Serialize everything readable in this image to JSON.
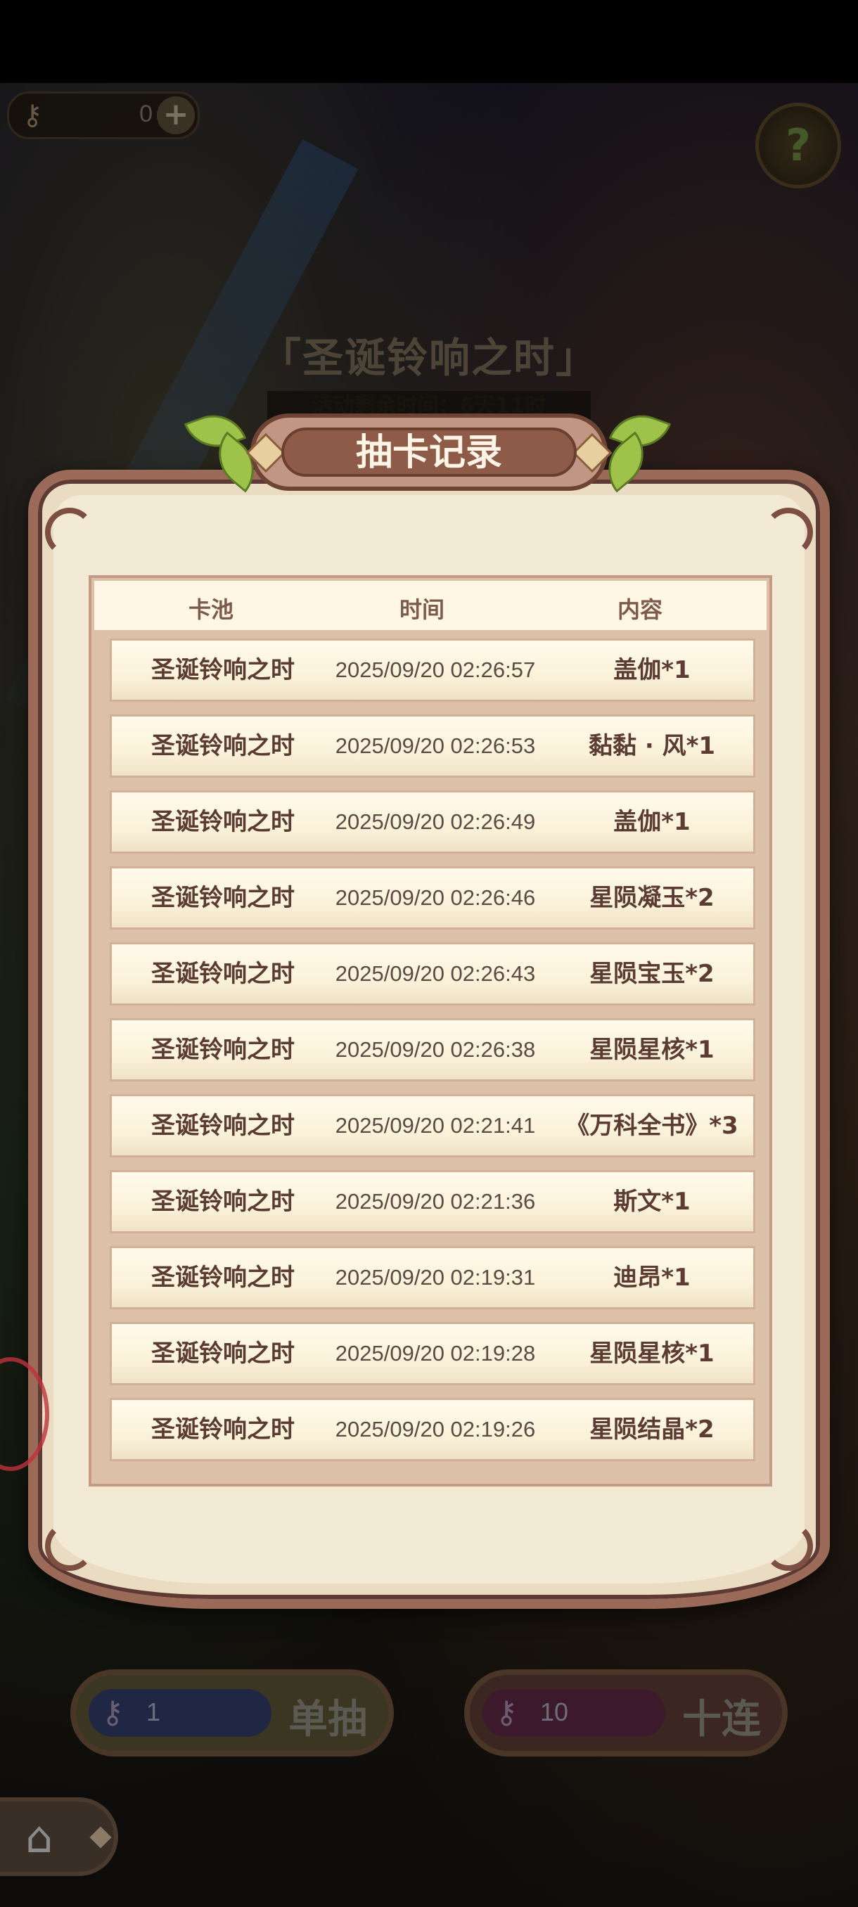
{
  "top_bar": {
    "key_count": "0",
    "plus_label": "+",
    "help_label": "?"
  },
  "event": {
    "title": "「圣诞铃响之时」",
    "timer": "活动剩余时间：6天11时"
  },
  "dialog": {
    "title": "抽卡记录",
    "columns": [
      "卡池",
      "时间",
      "内容"
    ],
    "rows": [
      {
        "pool": "圣诞铃响之时",
        "time": "2025/09/20 02:26:57",
        "item": "盖伽*1"
      },
      {
        "pool": "圣诞铃响之时",
        "time": "2025/09/20 02:26:53",
        "item": "黏黏 · 风*1"
      },
      {
        "pool": "圣诞铃响之时",
        "time": "2025/09/20 02:26:49",
        "item": "盖伽*1"
      },
      {
        "pool": "圣诞铃响之时",
        "time": "2025/09/20 02:26:46",
        "item": "星陨凝玉*2"
      },
      {
        "pool": "圣诞铃响之时",
        "time": "2025/09/20 02:26:43",
        "item": "星陨宝玉*2"
      },
      {
        "pool": "圣诞铃响之时",
        "time": "2025/09/20 02:26:38",
        "item": "星陨星核*1"
      },
      {
        "pool": "圣诞铃响之时",
        "time": "2025/09/20 02:21:41",
        "item": "《万科全书》*3"
      },
      {
        "pool": "圣诞铃响之时",
        "time": "2025/09/20 02:21:36",
        "item": "斯文*1"
      },
      {
        "pool": "圣诞铃响之时",
        "time": "2025/09/20 02:19:31",
        "item": "迪昂*1"
      },
      {
        "pool": "圣诞铃响之时",
        "time": "2025/09/20 02:19:28",
        "item": "星陨星核*1"
      },
      {
        "pool": "圣诞铃响之时",
        "time": "2025/09/20 02:19:26",
        "item": "星陨结晶*2"
      }
    ]
  },
  "buttons": {
    "single": {
      "cost": "1",
      "label": "单抽"
    },
    "ten": {
      "cost": "10",
      "label": "十连"
    }
  },
  "icons": {
    "key": "key-icon",
    "help": "sprout-help-icon",
    "home": "home-icon"
  }
}
